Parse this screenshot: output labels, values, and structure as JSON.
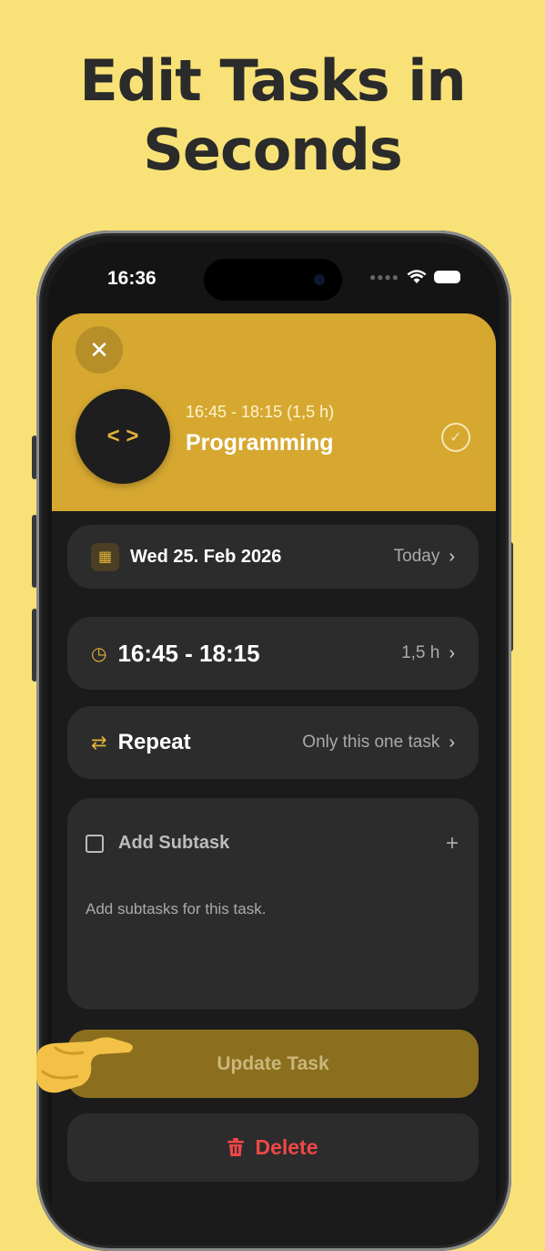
{
  "headline": {
    "line1": "Edit Tasks in",
    "line2": "Seconds"
  },
  "status_bar": {
    "time": "16:36"
  },
  "task": {
    "time_range": "16:45 - 18:15 (1,5 h)",
    "title": "Programming",
    "icon": "code-icon"
  },
  "date_row": {
    "label": "Wed 25. Feb 2026",
    "value": "Today"
  },
  "time_row": {
    "label": "16:45 - 18:15",
    "value": "1,5 h"
  },
  "repeat_row": {
    "label": "Repeat",
    "value": "Only this one task"
  },
  "subtasks": {
    "add_label": "Add Subtask",
    "hint": "Add subtasks for this task."
  },
  "buttons": {
    "update": "Update Task",
    "delete": "Delete"
  },
  "colors": {
    "background": "#f8e277",
    "accent": "#d6a830",
    "danger": "#ef4747"
  }
}
